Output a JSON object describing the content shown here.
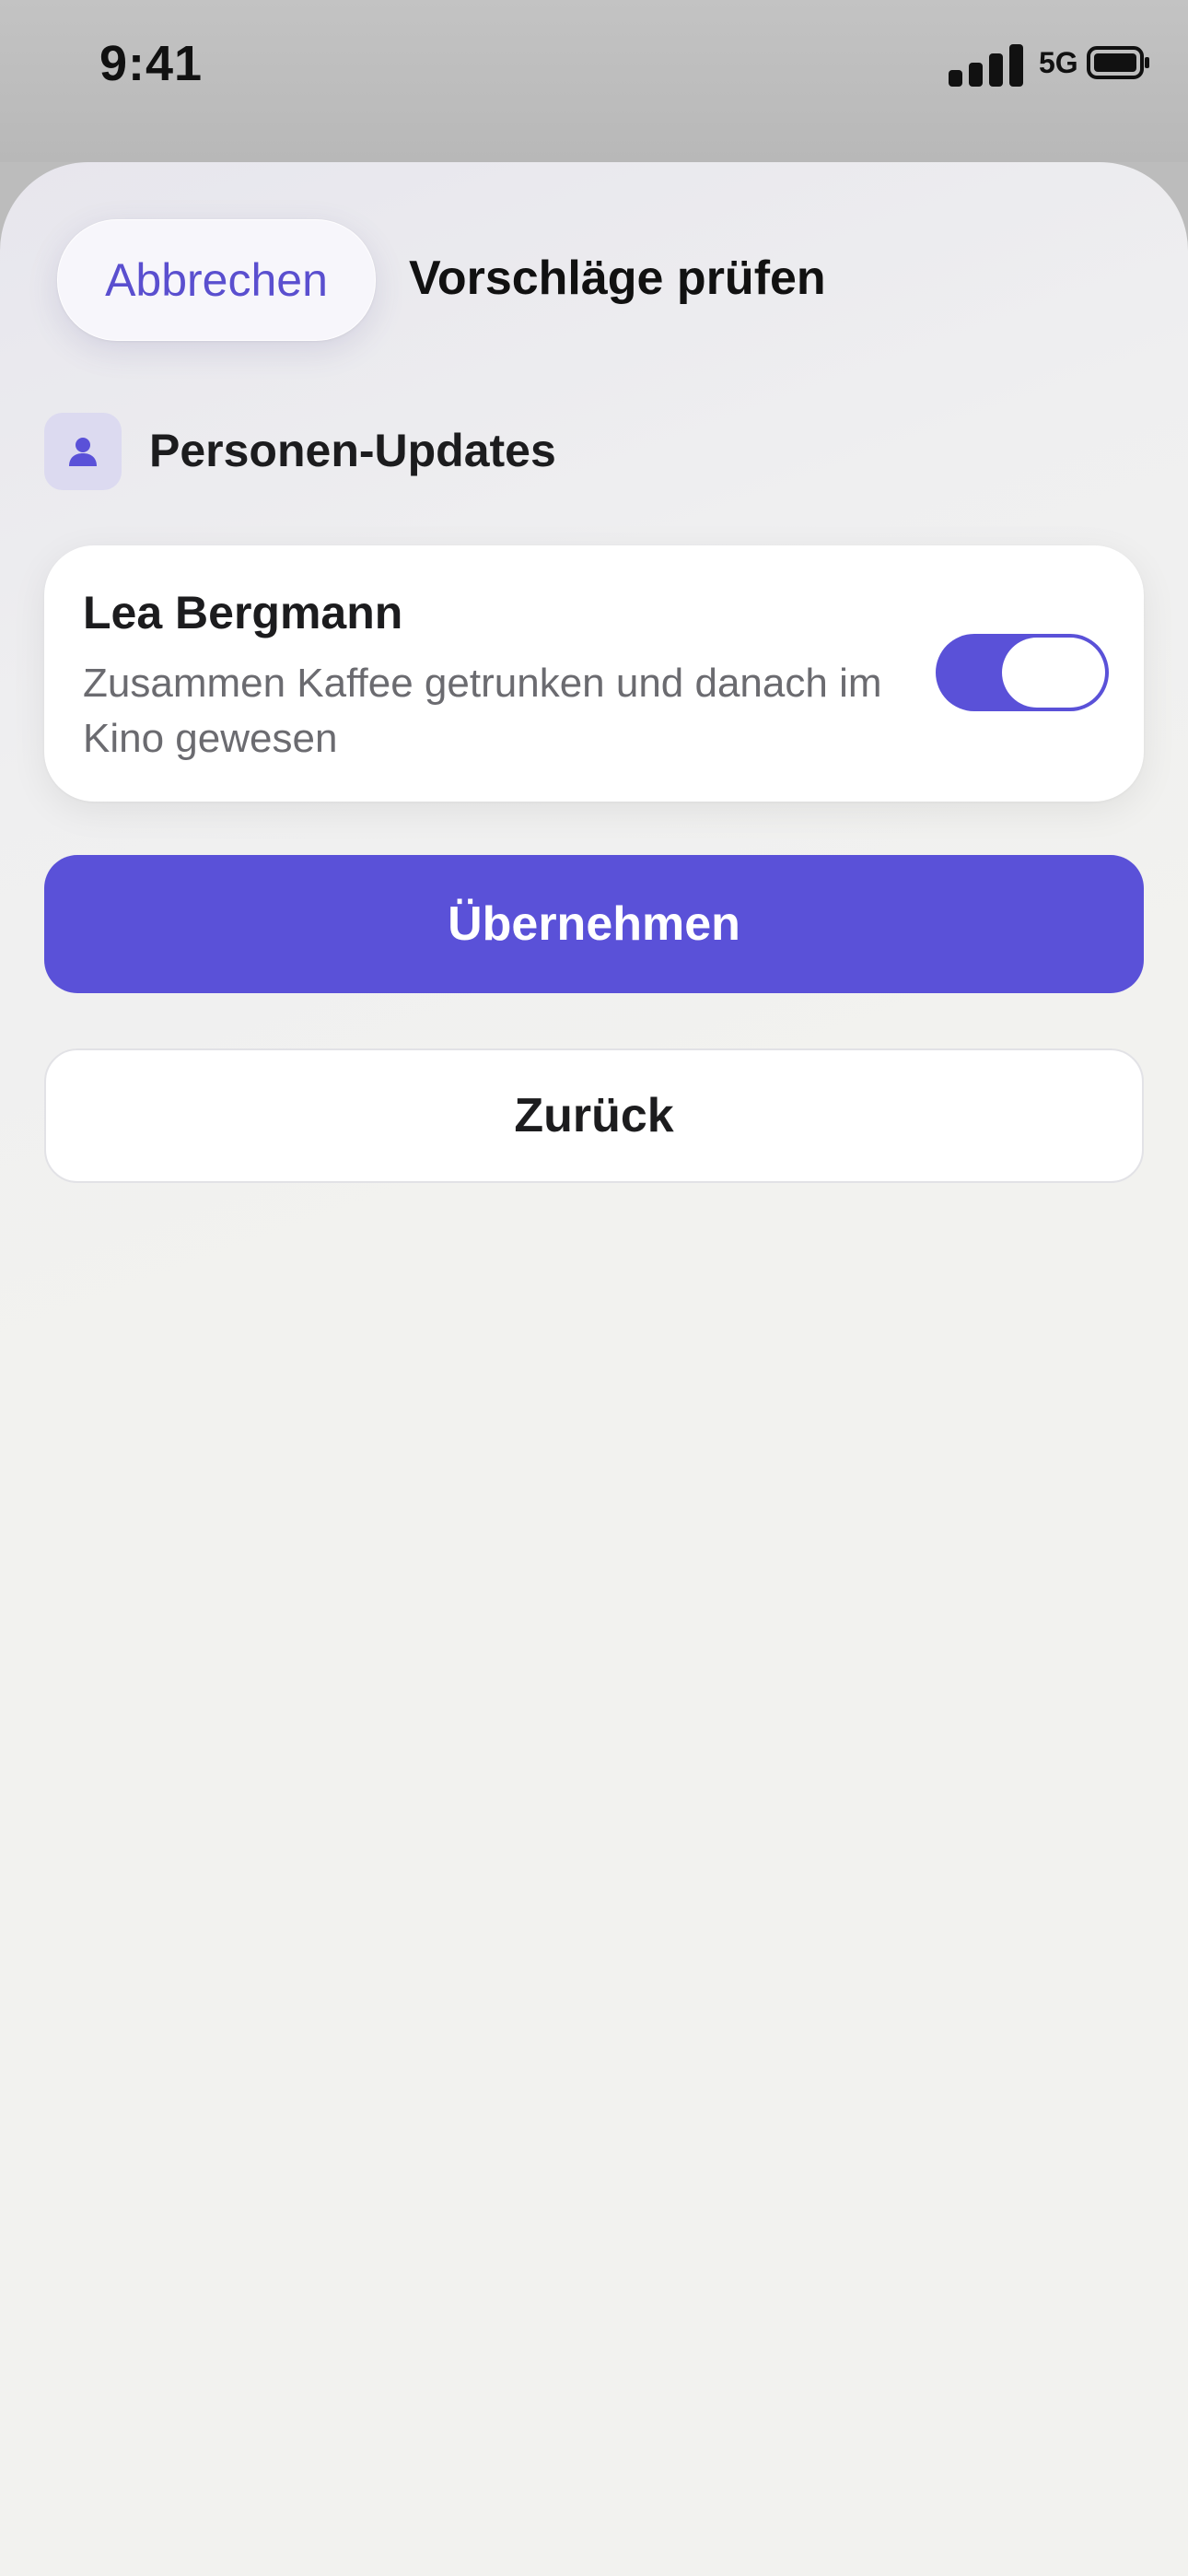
{
  "status_bar": {
    "time": "9:41",
    "network": "5G",
    "icons": [
      "cellular-signal-icon",
      "battery-icon"
    ]
  },
  "sheet": {
    "cancel_label": "Abbrechen",
    "title": "Vorschläge prüfen"
  },
  "section": {
    "icon": "person-icon",
    "title": "Personen-Updates"
  },
  "person_update": {
    "name": "Lea Bergmann",
    "description": "Zusammen Kaffee getrunken und danach im Kino gewesen",
    "enabled": true
  },
  "actions": {
    "apply_label": "Übernehmen",
    "back_label": "Zurück"
  },
  "colors": {
    "accent": "#5A51D8",
    "sheet_background": "#F2F2EF",
    "icon_tile": "#DCDAF0",
    "secondary_text": "#6B6B70"
  }
}
